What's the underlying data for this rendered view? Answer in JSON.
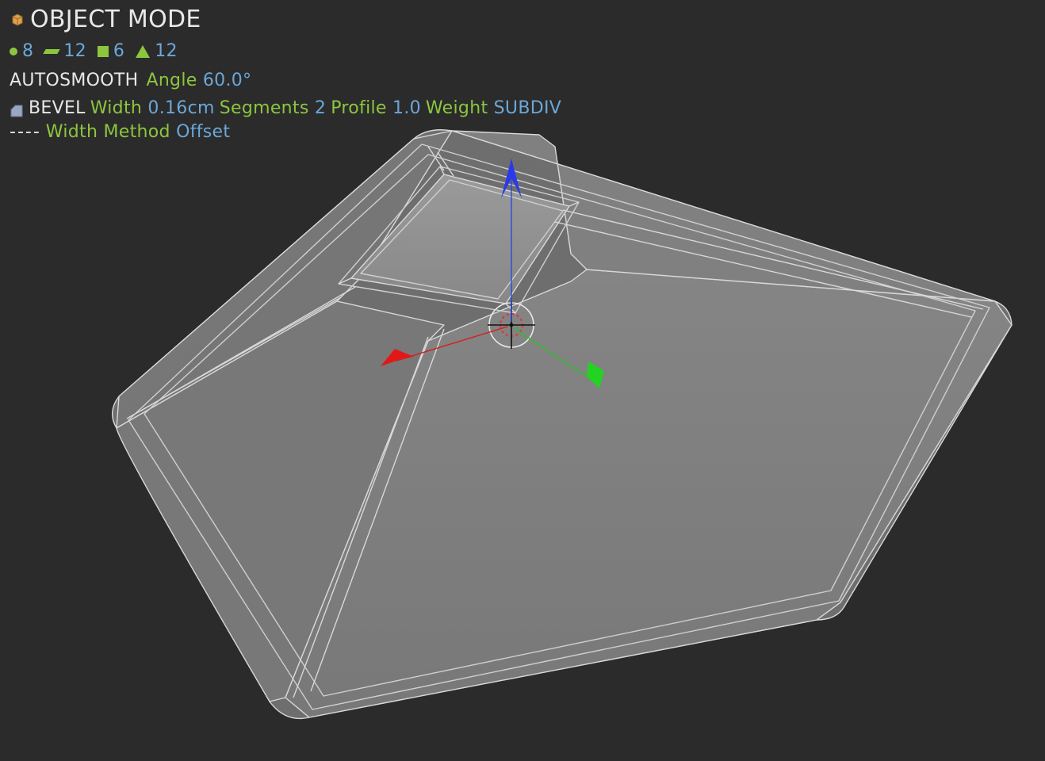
{
  "mode_title": "OBJECT MODE",
  "mesh_stats": {
    "verts": 8,
    "edges": 12,
    "faces": 6,
    "tris": 12
  },
  "autosmooth": {
    "label": "AUTOSMOOTH",
    "angle_key": "Angle",
    "angle_value": "60.0°"
  },
  "bevel": {
    "name": "BEVEL",
    "width_key": "Width",
    "width_value": "0.16cm",
    "segments_key": "Segments",
    "segments_value": "2",
    "profile_key": "Profile",
    "profile_value": "1.0",
    "weight_key": "Weight",
    "weight_value": "SUBDIV",
    "sub_dash": "----",
    "width_method_key": "Width Method",
    "width_method_value": "Offset"
  }
}
